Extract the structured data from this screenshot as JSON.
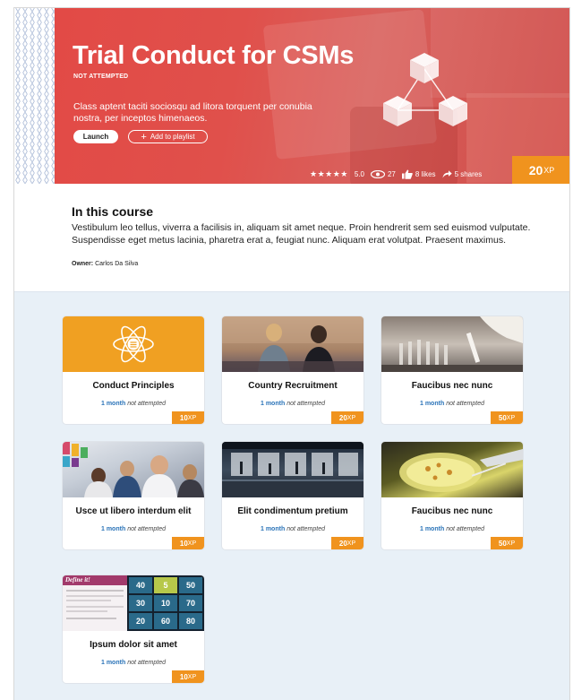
{
  "hero": {
    "title": "Trial Conduct for CSMs",
    "status": "NOT ATTEMPTED",
    "description": "Class aptent taciti sociosqu ad litora torquent per conubia nostra, per inceptos himenaeos.",
    "launch_label": "Launch",
    "playlist_label": "Add to playlist",
    "rating_stars": "★★★★★",
    "rating_value": "5.0",
    "views": "27",
    "likes": "8 likes",
    "shares": "5 shares",
    "xp_value": "20",
    "xp_unit": "XP"
  },
  "about": {
    "title": "In this course",
    "text": "Vestibulum leo tellus, viverra a facilisis in, aliquam sit amet neque. Proin hendrerit sem sed euismod vulputate. Suspendisse eget metus lacinia, pharetra erat a, feugiat nunc. Aliquam erat volutpat. Praesent maximus.",
    "owner_label": "Owner:",
    "owner_name": "Carlos Da Silva"
  },
  "cards": [
    {
      "title": "Conduct Principles",
      "duration": "1 month",
      "status": "not attempted",
      "xp": "10",
      "xp_unit": "XP",
      "image": "atom-icon"
    },
    {
      "title": "Country Recruitment",
      "duration": "1 month",
      "status": "not attempted",
      "xp": "20",
      "xp_unit": "XP",
      "image": "meeting-photo"
    },
    {
      "title": "Faucibus nec nunc",
      "duration": "1 month",
      "status": "not attempted",
      "xp": "50",
      "xp_unit": "XP",
      "image": "test-tubes-photo"
    },
    {
      "title": "Usce ut libero interdum elit",
      "duration": "1 month",
      "status": "not attempted",
      "xp": "10",
      "xp_unit": "XP",
      "image": "team-photo"
    },
    {
      "title": "Elit condimentum pretium",
      "duration": "1 month",
      "status": "not attempted",
      "xp": "20",
      "xp_unit": "XP",
      "image": "office-photo"
    },
    {
      "title": "Faucibus nec nunc",
      "duration": "1 month",
      "status": "not attempted",
      "xp": "50",
      "xp_unit": "XP",
      "image": "petri-dish-photo"
    },
    {
      "title": "Ipsum dolor sit amet",
      "duration": "1 month",
      "status": "not attempted",
      "xp": "10",
      "xp_unit": "XP",
      "image": "define-it-game"
    }
  ],
  "define_it": {
    "heading": "Define it!",
    "tiles": [
      "40",
      "5",
      "50",
      "30",
      "10",
      "70",
      "20",
      "60",
      "80"
    ]
  },
  "colors": {
    "accent_orange": "#f0931e",
    "hero_red": "#e24a46",
    "link_blue": "#2a73b8",
    "grid_bg": "#e8f0f7"
  }
}
